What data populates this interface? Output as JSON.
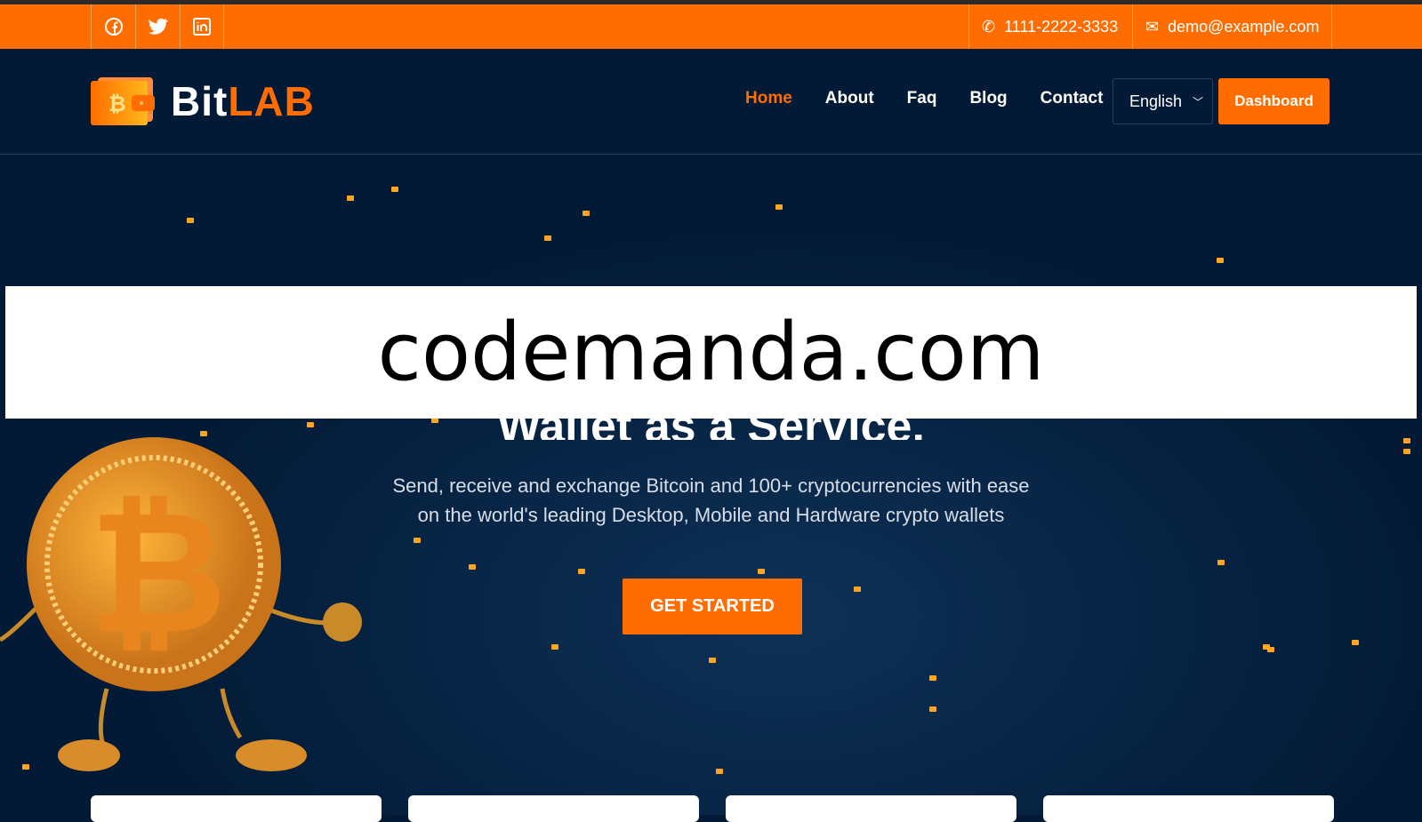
{
  "topbar": {
    "social": [
      "facebook-icon",
      "twitter-icon",
      "linkedin-icon"
    ],
    "phone": "1111-2222-3333",
    "email": "demo@example.com"
  },
  "logo": {
    "text_white": "Bit",
    "text_orange": "LAB"
  },
  "nav": {
    "items": [
      {
        "label": "Home",
        "active": true
      },
      {
        "label": "About"
      },
      {
        "label": "Faq"
      },
      {
        "label": "Blog"
      },
      {
        "label": "Contact"
      }
    ],
    "language": "English",
    "dashboard": "Dashboard"
  },
  "hero": {
    "title": "Wallet as a Service.",
    "subtitle_line1": "Send, receive and exchange Bitcoin and 100+ cryptocurrencies with ease",
    "subtitle_line2": "on the world's leading Desktop, Mobile and Hardware crypto wallets",
    "cta": "GET STARTED"
  },
  "watermark": "codemanda.com",
  "colors": {
    "accent": "#ff6d00",
    "background": "#021a35"
  }
}
